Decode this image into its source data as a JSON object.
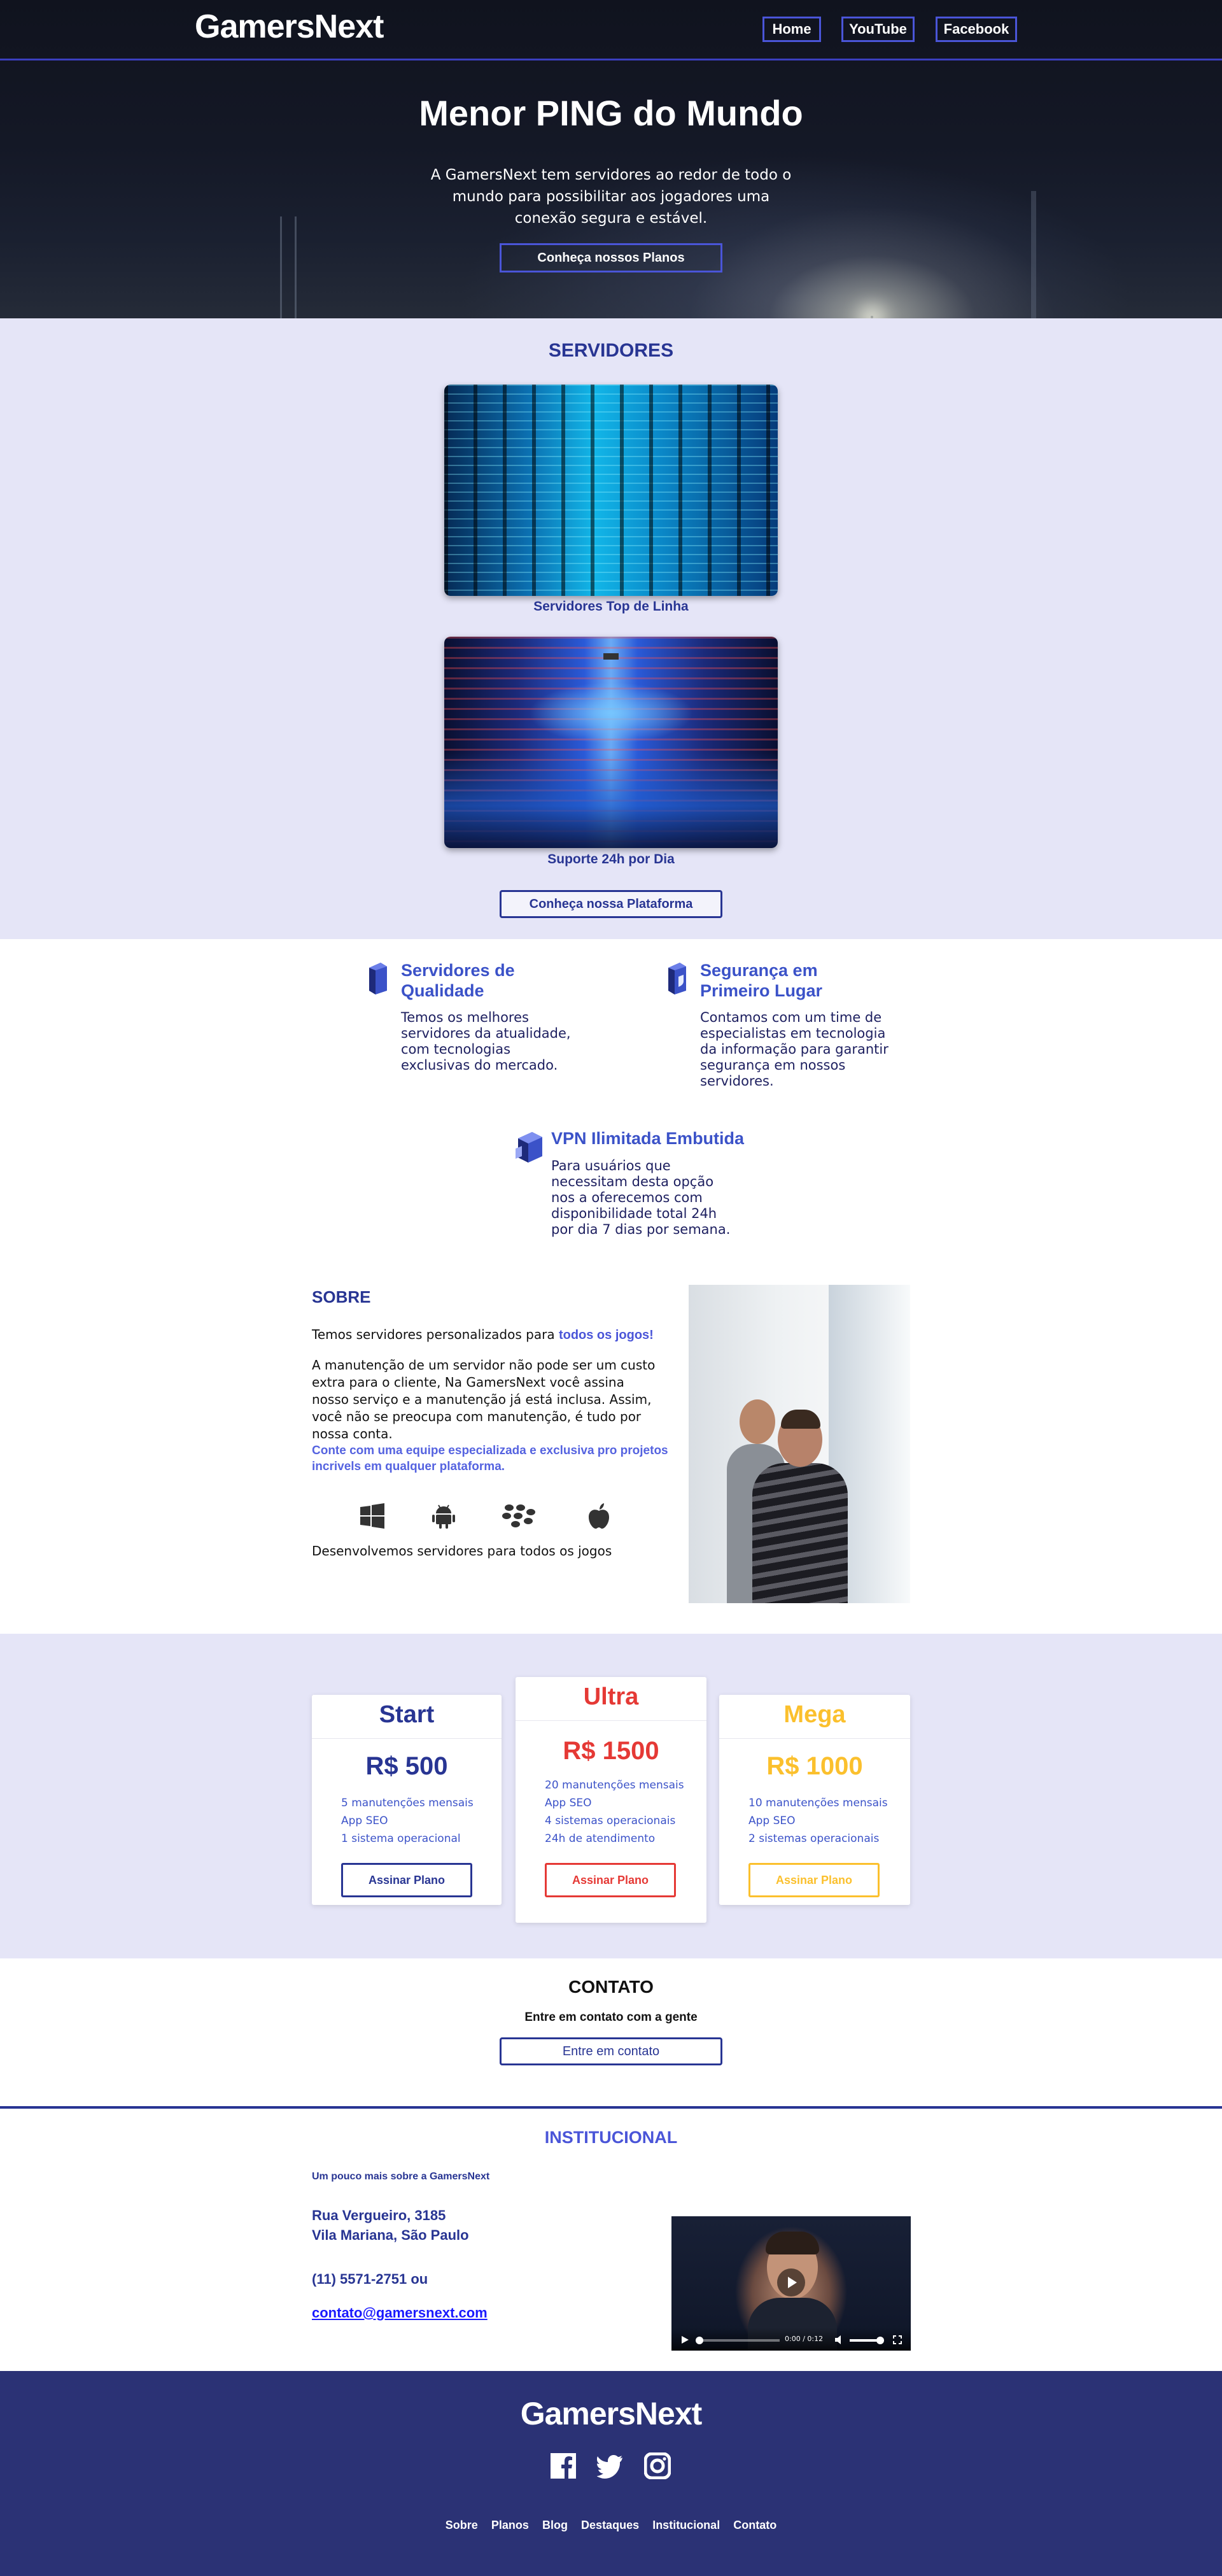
{
  "header": {
    "logo": "GamersNext",
    "nav": [
      "Home",
      "YouTube",
      "Facebook"
    ]
  },
  "hero": {
    "title": "Menor PING do Mundo",
    "text": "A GamersNext tem servidores ao redor de todo o mundo para possibilitar aos jogadores uma conexão segura e estável.",
    "cta": "Conheça nossos Planos"
  },
  "servers": {
    "title": "SERVIDORES",
    "captions": [
      "Servidores Top de Linha",
      "Suporte 24h por Dia"
    ],
    "cta": "Conheça nossa Plataforma"
  },
  "features": [
    {
      "title": "Servidores de Qualidade",
      "text": "Temos os melhores servidores da atualidade, com tecnologias exclusivas do mercado."
    },
    {
      "title": "Segurança em Primeiro Lugar",
      "text": "Contamos com um time de especialistas em tecnologia da informação para garantir segurança em nossos servidores."
    },
    {
      "title": "VPN Ilimitada Embutida",
      "text": "Para usuários que necessitam desta opção nos a oferecemos com disponibilidade total 24h por dia 7 dias por semana."
    }
  ],
  "about": {
    "title": "SOBRE",
    "p1_prefix": "Temos servidores personalizados para ",
    "p1_highlight": "todos os jogos!",
    "p2": "A manutenção de um servidor não pode ser um custo extra para o cliente, Na GamersNext você assina nosso serviço e a manutenção já está inclusa. Assim, você não se preocupa com manutenção, é tudo por nossa conta.",
    "highlight": "Conte com uma equipe especializada e exclusiva pro projetos incrivels em qualquer plataforma.",
    "os_icons": [
      "windows-icon",
      "android-icon",
      "blackberry-icon",
      "apple-icon"
    ],
    "footer": "Desenvolvemos servidores para todos os jogos"
  },
  "plans": [
    {
      "name": "Start",
      "price": "R$ 500",
      "color": "#283593",
      "features": [
        "5 manutenções mensais",
        "App SEO",
        "1 sistema operacional"
      ],
      "button": "Assinar Plano"
    },
    {
      "name": "Ultra",
      "price": "R$ 1500",
      "color": "#e53935",
      "features": [
        "20 manutenções mensais",
        "App SEO",
        "4 sistemas operacionais",
        "24h de atendimento"
      ],
      "button": "Assinar Plano"
    },
    {
      "name": "Mega",
      "price": "R$ 1000",
      "color": "#fbc02d",
      "features": [
        "10 manutenções mensais",
        "App SEO",
        "2 sistemas operacionais"
      ],
      "button": "Assinar Plano"
    }
  ],
  "contact": {
    "title": "CONTATO",
    "subtitle": "Entre em contato com a gente",
    "button": "Entre em contato"
  },
  "institutional": {
    "title": "INSTITUCIONAL",
    "subtitle": "Um pouco mais sobre a GamersNext",
    "address_line1": "Rua Vergueiro, 3185",
    "address_line2": "Vila Mariana, São Paulo",
    "phone": "(11) 5571-2751 ou",
    "email": "contato@gamersnext.com",
    "video_time": "0:00 / 0:12"
  },
  "footer": {
    "logo": "GamersNext",
    "social": [
      "facebook-icon",
      "twitter-icon",
      "instagram-icon"
    ],
    "links": [
      "Sobre",
      "Planos",
      "Blog",
      "Destaques",
      "Institucional",
      "Contato"
    ]
  },
  "colors": {
    "primary": "#283593",
    "accent": "#4a55d8",
    "section_bg": "#e5e5f7",
    "footer_bg": "#2b3275"
  }
}
